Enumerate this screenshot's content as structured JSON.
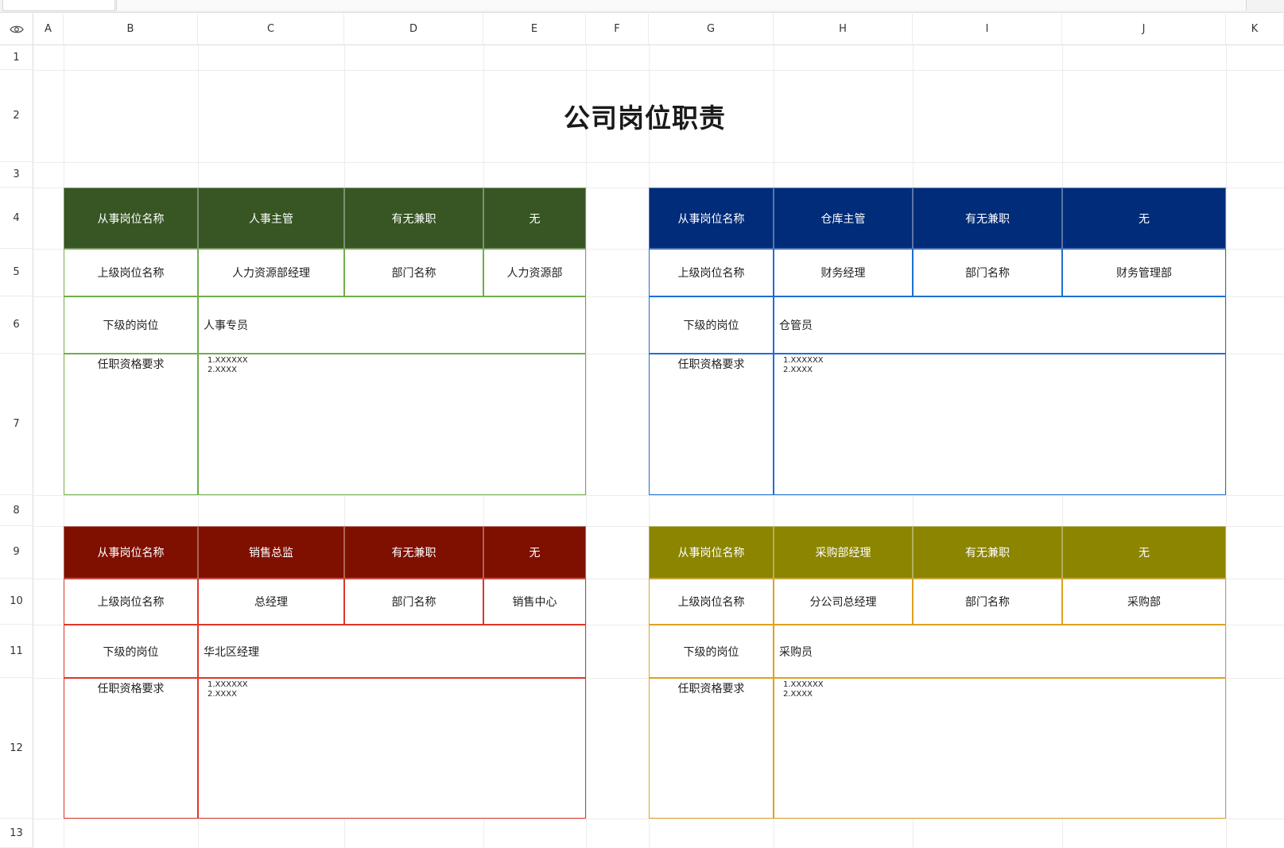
{
  "sheet": {
    "title": "公司岗位职责",
    "columns": [
      "A",
      "B",
      "C",
      "D",
      "E",
      "F",
      "G",
      "H",
      "I",
      "J",
      "K"
    ],
    "rows": [
      "1",
      "2",
      "3",
      "4",
      "5",
      "6",
      "7",
      "8",
      "9",
      "10",
      "11",
      "12",
      "13"
    ]
  },
  "blocks": [
    {
      "color": "#375623",
      "position_label": "从事岗位名称",
      "position_value": "人事主管",
      "parttime_label": "有无兼职",
      "parttime_value": "无",
      "superior_label": "上级岗位名称",
      "superior_value": "人力资源部经理",
      "dept_label": "部门名称",
      "dept_value": "人力资源部",
      "sub_label": "下级的岗位",
      "sub_value": "人事专员",
      "req_label": "任职资格要求",
      "req_value": "1.XXXXXX\n2.XXXX",
      "border_color": "#70ad47"
    },
    {
      "color": "#002c7a",
      "position_label": "从事岗位名称",
      "position_value": "仓库主管",
      "parttime_label": "有无兼职",
      "parttime_value": "无",
      "superior_label": "上级岗位名称",
      "superior_value": "财务经理",
      "dept_label": "部门名称",
      "dept_value": "财务管理部",
      "sub_label": "下级的岗位",
      "sub_value": "仓管员",
      "req_label": "任职资格要求",
      "req_value": "1.XXXXXX\n2.XXXX",
      "border_color": "#1f6fd1"
    },
    {
      "color": "#7f1000",
      "position_label": "从事岗位名称",
      "position_value": "销售总监",
      "parttime_label": "有无兼职",
      "parttime_value": "无",
      "superior_label": "上级岗位名称",
      "superior_value": "总经理",
      "dept_label": "部门名称",
      "dept_value": "销售中心",
      "sub_label": "下级的岗位",
      "sub_value": "华北区经理",
      "req_label": "任职资格要求",
      "req_value": "1.XXXXXX\n2.XXXX",
      "border_color": "#e0352b"
    },
    {
      "color": "#8c8500",
      "position_label": "从事岗位名称",
      "position_value": "采购部经理",
      "parttime_label": "有无兼职",
      "parttime_value": "无",
      "superior_label": "上级岗位名称",
      "superior_value": "分公司总经理",
      "dept_label": "部门名称",
      "dept_value": "采购部",
      "sub_label": "下级的岗位",
      "sub_value": "采购员",
      "req_label": "任职资格要求",
      "req_value": "1.XXXXXX\n2.XXXX",
      "border_color": "#e0a020"
    }
  ]
}
